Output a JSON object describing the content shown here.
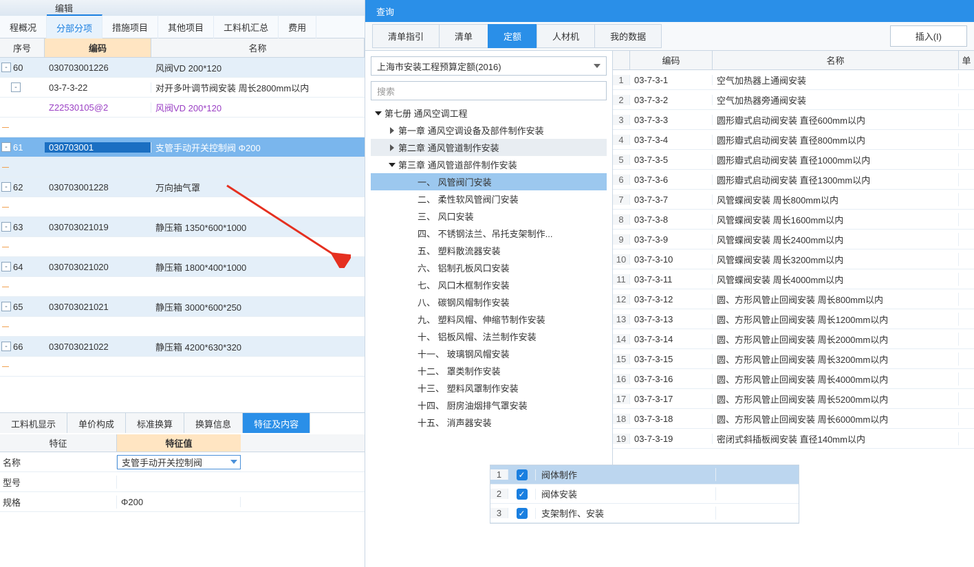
{
  "leftTitle": "编辑",
  "topTabs": [
    "程概况",
    "分部分项",
    "措施项目",
    "其他项目",
    "工料机汇总",
    "费用"
  ],
  "topTabActive": 1,
  "gridHeaders": {
    "seq": "序号",
    "code": "编码",
    "name": "名称"
  },
  "gridRows": [
    {
      "type": "main",
      "bg": "blue",
      "toggle": "-",
      "seq": "60",
      "code": "030703001226",
      "name": "风阀VD 200*120"
    },
    {
      "type": "sub",
      "bg": "",
      "toggle": "-",
      "seq": "",
      "code": "03-7-3-22",
      "name": "对开多叶调节阀安装  周长2800mm以内"
    },
    {
      "type": "sub",
      "bg": "",
      "toggle": "",
      "seq": "",
      "code": "Z22530105@2",
      "name": "风阀VD 200*120",
      "purple": true
    },
    {
      "type": "spacer"
    },
    {
      "type": "main",
      "bg": "sel",
      "toggle": "-",
      "seq": "61",
      "code": "030703001",
      "name": "支管手动开关控制阀 Φ200",
      "selected": true
    },
    {
      "type": "spacer",
      "bg": "blue"
    },
    {
      "type": "main",
      "bg": "blue",
      "toggle": "-",
      "seq": "62",
      "code": "030703001228",
      "name": "万向抽气罩"
    },
    {
      "type": "spacer"
    },
    {
      "type": "main",
      "bg": "blue",
      "toggle": "-",
      "seq": "63",
      "code": "030703021019",
      "name": "静压箱 1350*600*1000"
    },
    {
      "type": "spacer"
    },
    {
      "type": "main",
      "bg": "blue",
      "toggle": "-",
      "seq": "64",
      "code": "030703021020",
      "name": "静压箱 1800*400*1000"
    },
    {
      "type": "spacer"
    },
    {
      "type": "main",
      "bg": "blue",
      "toggle": "-",
      "seq": "65",
      "code": "030703021021",
      "name": "静压箱 3000*600*250"
    },
    {
      "type": "spacer"
    },
    {
      "type": "main",
      "bg": "blue",
      "toggle": "-",
      "seq": "66",
      "code": "030703021022",
      "name": "静压箱 4200*630*320"
    },
    {
      "type": "spacer"
    }
  ],
  "bottomTabs": [
    "工料机显示",
    "单价构成",
    "标准换算",
    "换算信息",
    "特征及内容"
  ],
  "bottomTabActive": 4,
  "featureHead": {
    "c1": "特征",
    "c2": "特征值"
  },
  "featureRows": [
    {
      "c1": "名称",
      "c2": "支管手动开关控制阀",
      "sel": true
    },
    {
      "c1": "型号",
      "c2": ""
    },
    {
      "c1": "规格",
      "c2": "Φ200"
    }
  ],
  "query": {
    "title": "查询",
    "tabs": [
      "清单指引",
      "清单",
      "定额",
      "人材机",
      "我的数据"
    ],
    "tabActive": 2,
    "insert": "插入(I)",
    "selectText": "上海市安装工程预算定额(2016)",
    "searchPlaceholder": "搜索",
    "tree": [
      {
        "lv": 1,
        "open": true,
        "text": "第七册 通风空调工程"
      },
      {
        "lv": 2,
        "open": false,
        "text": "第一章 通风空调设备及部件制作安装"
      },
      {
        "lv": 2,
        "open": false,
        "text": "第二章 通风管道制作安装",
        "hlgrey": true
      },
      {
        "lv": 2,
        "open": true,
        "text": "第三章 通风管道部件制作安装"
      },
      {
        "lv": 4,
        "text": "一、 风管阀门安装",
        "hlblue": true
      },
      {
        "lv": 4,
        "text": "二、 柔性软风管阀门安装"
      },
      {
        "lv": 4,
        "text": "三、 风口安装"
      },
      {
        "lv": 4,
        "text": "四、 不锈钢法兰、吊托支架制作..."
      },
      {
        "lv": 4,
        "text": "五、 塑料散流器安装"
      },
      {
        "lv": 4,
        "text": "六、 铝制孔板风口安装"
      },
      {
        "lv": 4,
        "text": "七、 风口木框制作安装"
      },
      {
        "lv": 4,
        "text": "八、 碳钢风帽制作安装"
      },
      {
        "lv": 4,
        "text": "九、 塑料风帽、伸缩节制作安装"
      },
      {
        "lv": 4,
        "text": "十、 铝板风帽、法兰制作安装"
      },
      {
        "lv": 4,
        "text": "十一、 玻璃钢风帽安装"
      },
      {
        "lv": 4,
        "text": "十二、 罩类制作安装"
      },
      {
        "lv": 4,
        "text": "十三、 塑料风罩制作安装"
      },
      {
        "lv": 4,
        "text": "十四、 厨房油烟排气罩安装"
      },
      {
        "lv": 4,
        "text": "十五、 消声器安装"
      }
    ],
    "dataHead": {
      "code": "编码",
      "name": "名称",
      "unit": "单"
    },
    "dataRows": [
      {
        "n": 1,
        "code": "03-7-3-1",
        "name": "空气加热器上通阀安装"
      },
      {
        "n": 2,
        "code": "03-7-3-2",
        "name": "空气加热器旁通阀安装"
      },
      {
        "n": 3,
        "code": "03-7-3-3",
        "name": "圆形瓣式启动阀安装  直径600mm以内"
      },
      {
        "n": 4,
        "code": "03-7-3-4",
        "name": "圆形瓣式启动阀安装  直径800mm以内"
      },
      {
        "n": 5,
        "code": "03-7-3-5",
        "name": "圆形瓣式启动阀安装  直径1000mm以内"
      },
      {
        "n": 6,
        "code": "03-7-3-6",
        "name": "圆形瓣式启动阀安装  直径1300mm以内"
      },
      {
        "n": 7,
        "code": "03-7-3-7",
        "name": "风管蝶阀安装  周长800mm以内"
      },
      {
        "n": 8,
        "code": "03-7-3-8",
        "name": "风管蝶阀安装  周长1600mm以内"
      },
      {
        "n": 9,
        "code": "03-7-3-9",
        "name": "风管蝶阀安装  周长2400mm以内"
      },
      {
        "n": 10,
        "code": "03-7-3-10",
        "name": "风管蝶阀安装  周长3200mm以内"
      },
      {
        "n": 11,
        "code": "03-7-3-11",
        "name": "风管蝶阀安装  周长4000mm以内"
      },
      {
        "n": 12,
        "code": "03-7-3-12",
        "name": "圆、方形风管止回阀安装  周长800mm以内"
      },
      {
        "n": 13,
        "code": "03-7-3-13",
        "name": "圆、方形风管止回阀安装  周长1200mm以内"
      },
      {
        "n": 14,
        "code": "03-7-3-14",
        "name": "圆、方形风管止回阀安装  周长2000mm以内"
      },
      {
        "n": 15,
        "code": "03-7-3-15",
        "name": "圆、方形风管止回阀安装  周长3200mm以内"
      },
      {
        "n": 16,
        "code": "03-7-3-16",
        "name": "圆、方形风管止回阀安装  周长4000mm以内"
      },
      {
        "n": 17,
        "code": "03-7-3-17",
        "name": "圆、方形风管止回阀安装  周长5200mm以内"
      },
      {
        "n": 18,
        "code": "03-7-3-18",
        "name": "圆、方形风管止回阀安装  周长6000mm以内"
      },
      {
        "n": 19,
        "code": "03-7-3-19",
        "name": "密闭式斜插板阀安装  直径140mm以内"
      }
    ]
  },
  "checklist": [
    {
      "n": 1,
      "label": "阀体制作",
      "hl": true
    },
    {
      "n": 2,
      "label": "阀体安装"
    },
    {
      "n": 3,
      "label": "支架制作、安装"
    }
  ]
}
